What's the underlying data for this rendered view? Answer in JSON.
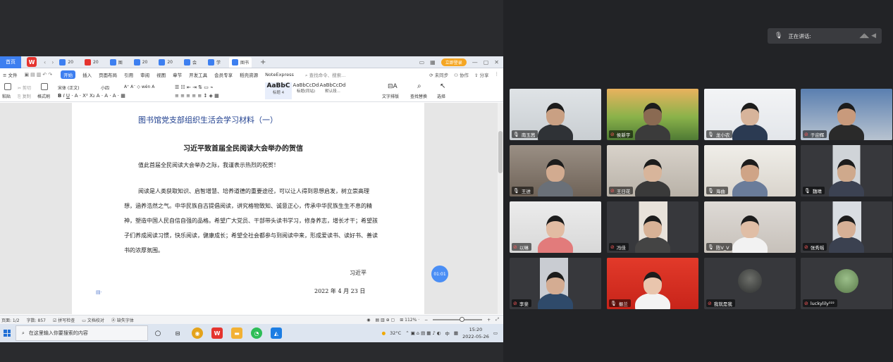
{
  "wps": {
    "home_tab": "首页",
    "doc_tabs": [
      "20",
      "20",
      "图",
      "20",
      "20",
      "会",
      "学",
      "图书"
    ],
    "login_label": "立即登录",
    "menus": {
      "file": "文件",
      "items": [
        "开始",
        "插入",
        "页面布局",
        "引用",
        "审阅",
        "视图",
        "章节",
        "开发工具",
        "会员专享",
        "稻壳资源",
        "NoteExpress"
      ],
      "search": "查找命令、搜索...",
      "right": [
        "未同步",
        "协作",
        "分享"
      ]
    },
    "ribbon": {
      "paste": "粘贴",
      "cut": "剪切",
      "copy": "复制",
      "format_painter": "格式刷",
      "font_name": "宋体 (正文)",
      "font_size": "小四",
      "styles": [
        {
          "sample": "AaBbC",
          "label": "标题 4"
        },
        {
          "sample": "AaBbCcDd",
          "label": "标题(同站)"
        },
        {
          "sample": "AaBbCcDd",
          "label": "默认段..."
        }
      ],
      "text_layout": "文字排版",
      "find_replace": "查找替换",
      "select": "选择"
    },
    "document": {
      "title": "图书馆党支部组织生活会学习材料（一）",
      "subtitle": "习近平致首届全民阅读大会举办的贺信",
      "greeting": "值此首届全民阅读大会举办之际，我谨表示热烈的祝贺！",
      "body": "阅读是人类获取知识、启智增慧、培养道德的重要途径，可以让人得到思想启发，树立崇高理想，涵养浩然之气。中华民族自古提倡阅读，讲究格物致知、诚意正心，传承中华民族生生不息的精神，塑造中国人民自信自强的品格。希望广大党员、干部带头读书学习，修身养志，增长才干；希望孩子们养成阅读习惯，快乐阅读，健康成长；希望全社会都参与到阅读中来，形成爱读书、读好书、善读书的浓厚氛围。",
      "signature": "习近平",
      "date": "2022 年 4 月 23 日"
    },
    "timer": "01:01",
    "status": {
      "page": "页面: 1/2",
      "words": "字数: 857",
      "spell": "拼写检查",
      "proof": "文档校对",
      "font_missing": "缺失字体",
      "zoom": "112%"
    }
  },
  "taskbar": {
    "search_placeholder": "在这里输入你要搜索的内容",
    "weather": "32°C",
    "ime": "中",
    "time": "15:20",
    "date": "2022-05-26"
  },
  "meeting": {
    "speaking_label": "正在讲话:",
    "participants": [
      {
        "name": "南玉茜"
      },
      {
        "name": "侯新宇"
      },
      {
        "name": "龙小农"
      },
      {
        "name": "于迎辉"
      },
      {
        "name": "王进"
      },
      {
        "name": "王日花"
      },
      {
        "name": "海曲"
      },
      {
        "name": "魏晴"
      },
      {
        "name": "以琳"
      },
      {
        "name": "冯佳"
      },
      {
        "name": "陈V_V"
      },
      {
        "name": "张秀瑶"
      },
      {
        "name": "李斐"
      },
      {
        "name": "振兰"
      },
      {
        "name": "我就是我"
      },
      {
        "name": "luckylily²²²"
      }
    ]
  }
}
